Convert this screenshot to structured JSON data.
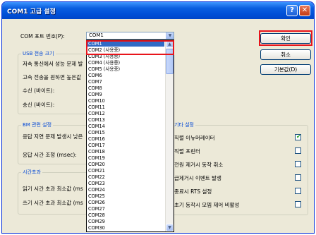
{
  "window": {
    "title": "COM1 고급 설정"
  },
  "titlebar": {
    "help_label": "?",
    "close_label": "✕"
  },
  "com_port": {
    "label": "COM 포트 번호(P):",
    "value": "COM1"
  },
  "buttons": {
    "ok": "확인",
    "cancel": "취소",
    "defaults": "기본값(D)"
  },
  "usb_group": {
    "title": "USB 전송 크기",
    "line1": "저속 통신에서 성능 문제 발",
    "line2": "고속 전송을 원하면 높은값",
    "receive": "수신 (바이트):",
    "send": "송신 (바이트):"
  },
  "bm_group": {
    "title": "BM 관련 설정",
    "line1": "응답 지연 문제 발생시 낮은",
    "latency": "응답 시간 조정 (msec):"
  },
  "timeout_group": {
    "title": "시간초과",
    "read": "읽기 시간 초과 최소값 (ms",
    "write": "쓰기 시간 초과 최소값 (ms"
  },
  "misc_group": {
    "title": "기타 설정",
    "items": [
      {
        "label": "직렬 이뉴머레이터",
        "checked": true
      },
      {
        "label": "직렬 프린터",
        "checked": false
      },
      {
        "label": "전원 제거시 동작 취소",
        "checked": false
      },
      {
        "label": "급제거시 이벤트 발생",
        "checked": false
      },
      {
        "label": "종료시 RTS 설정",
        "checked": false
      },
      {
        "label": "초기 동작시 모뎀 제어 비활성",
        "checked": false
      }
    ]
  },
  "dropdown": {
    "options": [
      "COM1",
      "COM2 (사용중)",
      "COM3 (사용중)",
      "COM4 (사용중)",
      "COM5 (사용중)",
      "COM6",
      "COM7",
      "COM8",
      "COM9",
      "COM10",
      "COM11",
      "COM12",
      "COM13",
      "COM14",
      "COM15",
      "COM16",
      "COM17",
      "COM18",
      "COM19",
      "COM20",
      "COM21",
      "COM22",
      "COM23",
      "COM24",
      "COM25",
      "COM26",
      "COM27",
      "COM28",
      "COM29",
      "COM30"
    ],
    "selected_index": 0
  },
  "colors": {
    "highlight": "#e8141b",
    "selection": "#316ac5",
    "group_title": "#0046d5"
  }
}
